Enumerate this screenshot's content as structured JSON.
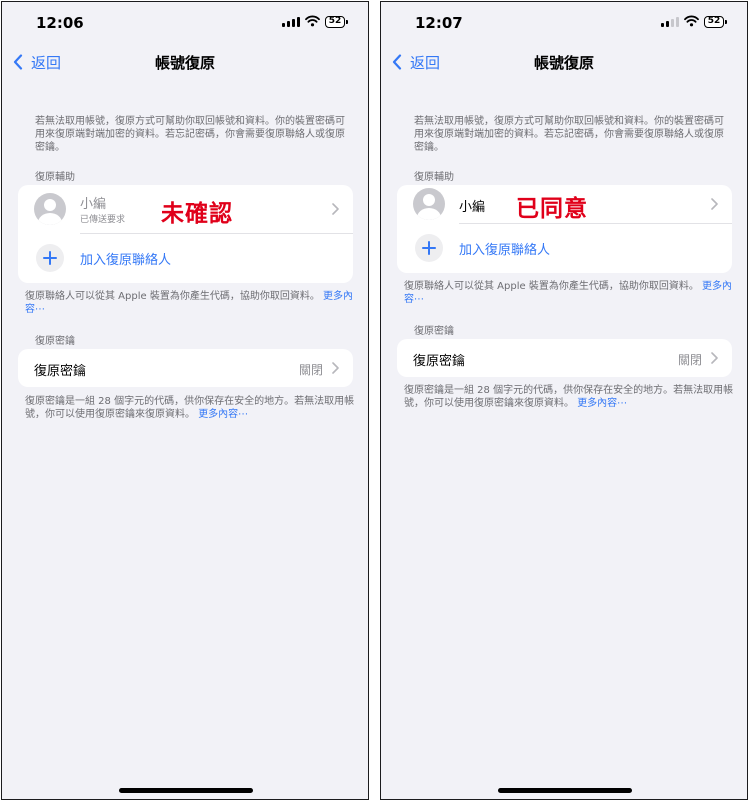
{
  "left": {
    "status": {
      "time": "12:06",
      "battery": "52"
    },
    "nav": {
      "back": "返回",
      "title": "帳號復原"
    },
    "intro": "若無法取用帳號，復原方式可幫助你取回帳號和資料。你的裝置密碼可用來復原端對端加密的資料。若忘記密碼，你會需要復原聯絡人或復原密鑰。",
    "assist_header": "復原輔助",
    "contact": {
      "name": "小編",
      "status": "已傳送要求"
    },
    "annotation": "未確認",
    "add_contact": "加入復原聯絡人",
    "contact_footer": "復原聯絡人可以從其 Apple 裝置為你產生代碼，協助你取回資料。",
    "contact_footer_link": "更多內容⋯",
    "key_header": "復原密鑰",
    "key": {
      "label": "復原密鑰",
      "value": "關閉"
    },
    "key_footer": "復原密鑰是一組 28 個字元的代碼，供你保存在安全的地方。若無法取用帳號，你可以使用復原密鑰來復原資料。",
    "key_footer_link": "更多內容⋯"
  },
  "right": {
    "status": {
      "time": "12:07",
      "battery": "52"
    },
    "nav": {
      "back": "返回",
      "title": "帳號復原"
    },
    "intro": "若無法取用帳號，復原方式可幫助你取回帳號和資料。你的裝置密碼可用來復原端對端加密的資料。若忘記密碼，你會需要復原聯絡人或復原密鑰。",
    "assist_header": "復原輔助",
    "contact": {
      "name": "小編"
    },
    "annotation": "已同意",
    "add_contact": "加入復原聯絡人",
    "contact_footer": "復原聯絡人可以從其 Apple 裝置為你產生代碼，協助你取回資料。",
    "contact_footer_link": "更多內容⋯",
    "key_header": "復原密鑰",
    "key": {
      "label": "復原密鑰",
      "value": "關閉"
    },
    "key_footer": "復原密鑰是一組 28 個字元的代碼，供你保存在安全的地方。若無法取用帳號，你可以使用復原密鑰來復原資料。",
    "key_footer_link": "更多內容⋯"
  },
  "colors": {
    "accent": "#3478f6",
    "annotation": "#e0001a",
    "background": "#f2f2f7"
  },
  "icons": [
    "back-chevron-icon",
    "chevron-right-icon",
    "add-icon",
    "avatar-icon",
    "signal-icon",
    "wifi-icon",
    "battery-icon"
  ]
}
